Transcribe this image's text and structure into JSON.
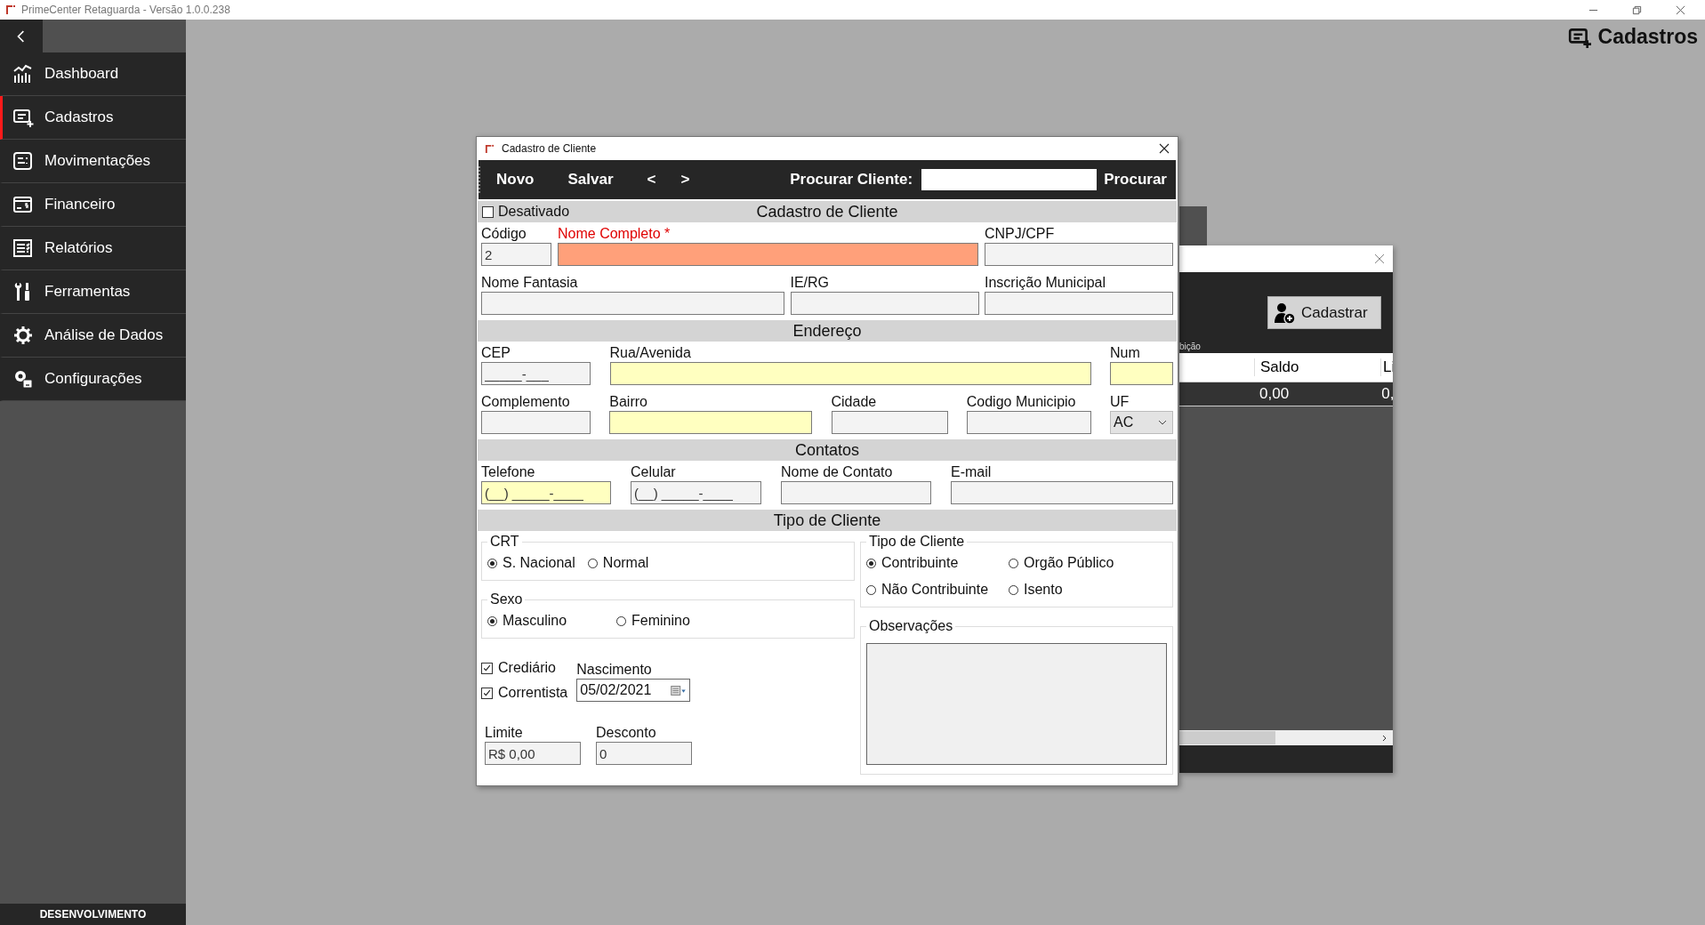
{
  "app_title": "PrimeCenter Retaguarda - Versão 1.0.0.238",
  "sidebar": {
    "items": [
      {
        "label": "Dashboard",
        "selected": false
      },
      {
        "label": "Cadastros",
        "selected": true
      },
      {
        "label": "Movimentações",
        "selected": false
      },
      {
        "label": "Financeiro",
        "selected": false
      },
      {
        "label": "Relatórios",
        "selected": false
      },
      {
        "label": "Ferramentas",
        "selected": false
      },
      {
        "label": "Análise de Dados",
        "selected": false
      },
      {
        "label": "Configurações",
        "selected": false
      }
    ],
    "footer": "DESENVOLVIMENTO"
  },
  "page_header": "Cadastros",
  "background_window": {
    "caption": "bição",
    "button": "Cadastrar",
    "columns": [
      "Saldo",
      "Li"
    ],
    "rows": [
      [
        "0,00",
        "0,"
      ]
    ]
  },
  "dialog": {
    "title": "Cadastro de Cliente",
    "toolbar": {
      "buttons": [
        "Novo",
        "Salvar",
        "<",
        ">"
      ],
      "search_label": "Procurar Cliente:",
      "search_button": "Procurar"
    },
    "inactive": {
      "label": "Desativado",
      "checked": false
    },
    "sections": [
      {
        "title": "Cadastro de Cliente",
        "lines": [
          {
            "fields": [
              {
                "label": "Código",
                "value": "2",
                "required": false
              },
              {
                "label": "Nome Completo *",
                "required": true,
                "color": "#ffa07a"
              },
              {
                "label": "CNPJ/CPF",
                "required": false
              }
            ]
          },
          {
            "fields": [
              {
                "label": "Nome Fantasia",
                "required": false
              },
              {
                "label": "IE/RG",
                "required": false
              },
              {
                "label": "Inscrição Municipal",
                "required": false
              }
            ]
          }
        ]
      },
      {
        "title": "Endereço",
        "lines": [
          {
            "fields": [
              {
                "label": "CEP",
                "value": "_____-___",
                "required": false
              },
              {
                "label": "Rua/Avenida",
                "required": false,
                "color": "#ffffc0"
              },
              {
                "label": "Num",
                "required": false,
                "color": "#ffffc0"
              }
            ]
          },
          {
            "fields": [
              {
                "label": "Complemento",
                "required": false
              },
              {
                "label": "Bairro",
                "required": false,
                "color": "#ffffc0"
              },
              {
                "label": "Cidade",
                "required": false
              },
              {
                "label": "Codigo Municipio",
                "required": false
              },
              {
                "label": "UF",
                "value": "AC",
                "required": false,
                "kind": "select"
              }
            ]
          }
        ]
      },
      {
        "title": "Contatos",
        "lines": [
          {
            "fields": [
              {
                "label": "Telefone",
                "value": "(__) _____-____",
                "required": false,
                "color": "#ffffc0"
              },
              {
                "label": "Celular",
                "value": "(__) _____-____",
                "required": false
              },
              {
                "label": "Nome de Contato",
                "required": false
              },
              {
                "label": "E-mail",
                "required": false
              }
            ]
          }
        ]
      },
      {
        "title": "Tipo de Cliente"
      }
    ],
    "crt": {
      "title": "CRT",
      "options": [
        {
          "label": "S. Nacional",
          "selected": true
        },
        {
          "label": "Normal",
          "selected": false
        }
      ]
    },
    "sexo": {
      "title": "Sexo",
      "options": [
        {
          "label": "Masculino",
          "selected": true
        },
        {
          "label": "Feminino",
          "selected": false
        }
      ]
    },
    "flags": [
      {
        "label": "Crediário",
        "checked": true
      },
      {
        "label": "Correntista",
        "checked": true
      }
    ],
    "birth": {
      "label": "Nascimento",
      "value": "05/02/2021"
    },
    "limit": {
      "label": "Limite",
      "value": "R$ 0,00"
    },
    "discount": {
      "label": "Desconto",
      "value": "0"
    },
    "client_type": {
      "title": "Tipo de Cliente",
      "options": [
        {
          "label": "Contribuinte",
          "selected": true
        },
        {
          "label": "Orgão Público",
          "selected": false
        },
        {
          "label": "Não Contribuinte",
          "selected": false
        },
        {
          "label": "Isento",
          "selected": false
        }
      ]
    },
    "notes": {
      "title": "Observações"
    }
  }
}
